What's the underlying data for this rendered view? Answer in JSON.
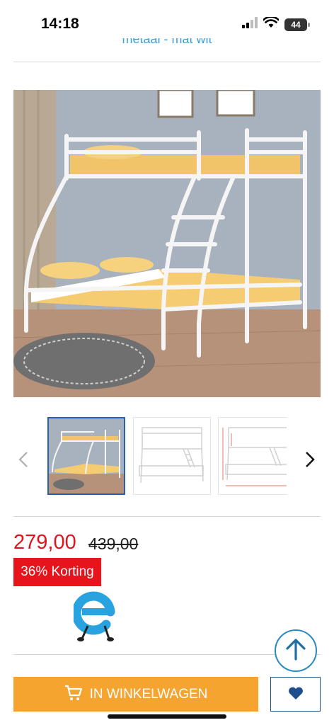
{
  "status_bar": {
    "time": "14:18",
    "battery_level": "44",
    "icons": [
      "signal-icon",
      "wifi-icon",
      "battery-icon"
    ]
  },
  "product": {
    "subtitle_partial": "metaal - mat wit",
    "price": "279,00",
    "old_price": "439,00",
    "discount_label": "36% Korting"
  },
  "gallery": {
    "thumbnails": [
      {
        "name": "bunk-bed-room-photo",
        "selected": true
      },
      {
        "name": "bunk-bed-white-background",
        "selected": false
      },
      {
        "name": "bunk-bed-dimensions",
        "selected": false
      }
    ]
  },
  "actions": {
    "cart_label": "IN WINKELWAGEN"
  },
  "colors": {
    "accent_blue": "#3ba0d8",
    "price_red": "#e0141e",
    "badge_red": "#e8141c",
    "cart_orange": "#f5a42f",
    "navy": "#1e4f8c"
  }
}
